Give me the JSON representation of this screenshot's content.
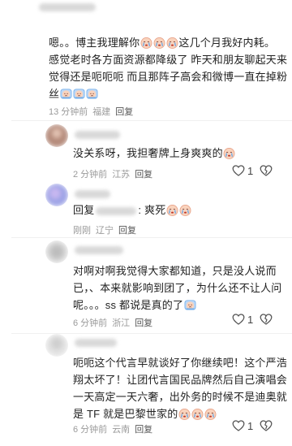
{
  "comments": [
    {
      "lines": [
        "嗯。。博主我理解你",
        "这几个月我好内耗。",
        "感觉老时各方面资源都降级了 昨天和朋友聊起天来",
        "觉得还是呃呃呃 而且那阵子高会和微博一直在掉粉",
        "丝"
      ],
      "time": "13 分钟前",
      "location": "福建",
      "reply": "回复"
    },
    {
      "text": "没关系呀，我担奢牌上身爽爽的",
      "time": "2 分钟前",
      "location": "江苏",
      "reply": "回复",
      "likes": "1"
    },
    {
      "prefix": "回复",
      "text": ": 爽死",
      "time": "刚刚",
      "location": "辽宁",
      "reply": "回复"
    },
    {
      "lines": [
        "对啊对啊我觉得大家都知道，只是没人说而",
        "已，、本来就影响到团了，为什么还不让人问",
        "呢。。。ss 都说是真的了"
      ],
      "time": "6 分钟前",
      "location": "浙江",
      "reply": "回复",
      "likes": "1"
    },
    {
      "lines": [
        "呃呃这个代言早就谈好了你继续吧！这个严浩",
        "翔太坏了！让团代言国民品牌然后自己演唱会",
        "一天高定一天六奢，出外务的时候不是迪奥就",
        "是 TF 就是巴黎世家的"
      ],
      "time": "6 分钟前",
      "location": "云南",
      "reply": "回复",
      "likes": "1"
    }
  ],
  "icons": {
    "emoji": "crying-face-emoji",
    "like": "heart-outline-icon",
    "dislike": "broken-heart-outline-icon"
  },
  "colors": {
    "meta": "#9a9a9a",
    "text": "#222222",
    "emoji_face": "#f6c8ae",
    "emoji_tear": "#6aa8e8"
  }
}
